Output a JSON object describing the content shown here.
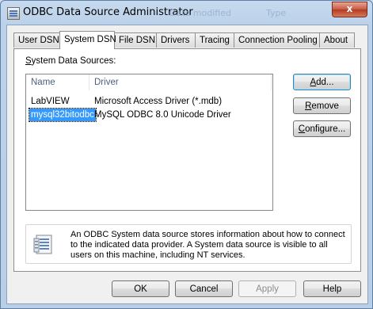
{
  "window": {
    "title": "ODBC Data Source Administrator",
    "close_glyph": "x",
    "background_hints": [
      "Date modified",
      "Type"
    ]
  },
  "tabs": [
    {
      "label": "User DSN",
      "active": false
    },
    {
      "label": "System DSN",
      "active": true
    },
    {
      "label": "File DSN",
      "active": false
    },
    {
      "label": "Drivers",
      "active": false
    },
    {
      "label": "Tracing",
      "active": false
    },
    {
      "label": "Connection Pooling",
      "active": false
    },
    {
      "label": "About",
      "active": false
    }
  ],
  "panel": {
    "list_label_prefix": "S",
    "list_label_rest": "ystem Data Sources:",
    "columns": [
      "Name",
      "Driver"
    ],
    "rows": [
      {
        "name": "LabVIEW",
        "driver": "Microsoft Access Driver (*.mdb)",
        "selected": false
      },
      {
        "name": "mysql32bitodbc",
        "driver": "MySQL ODBC 8.0 Unicode Driver",
        "selected": true
      }
    ],
    "buttons": {
      "add": {
        "mnemonic": "A",
        "rest": "dd..."
      },
      "remove": {
        "mnemonic": "R",
        "rest": "emove"
      },
      "configure": {
        "mnemonic": "C",
        "rest": "onfigure..."
      }
    },
    "info_icon": "data-source-info-icon",
    "info_text": "An ODBC System data source stores information about how to connect to the indicated data provider.   A System data source is visible to all users on this machine, including NT services."
  },
  "footer": {
    "ok": "OK",
    "cancel": "Cancel",
    "apply": "Apply",
    "help": "Help"
  },
  "colors": {
    "selection": "#3399ff",
    "close_button": "#c75a43",
    "title_bar": "#bcd2ea"
  }
}
